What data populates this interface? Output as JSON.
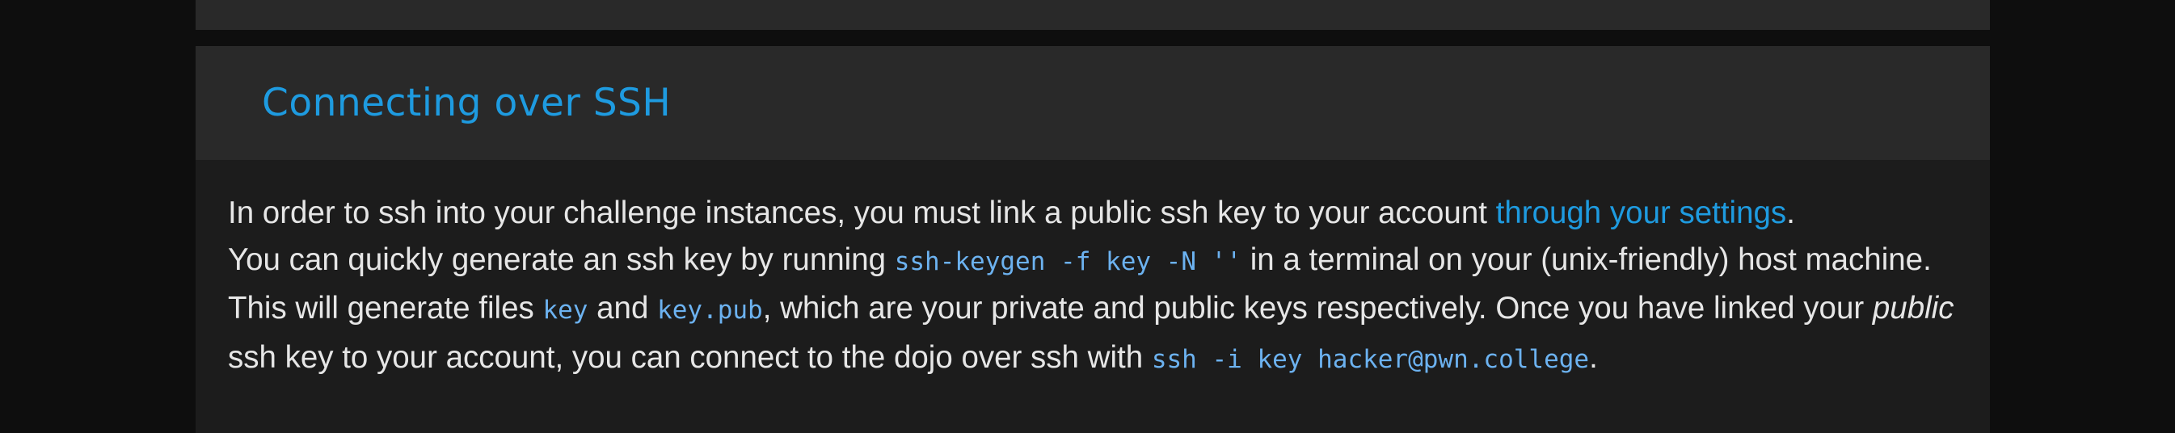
{
  "card": {
    "title": "Connecting over SSH"
  },
  "paragraph": {
    "s1_pre": "In order to ssh into your challenge instances, you must link a public ssh key to your account ",
    "settings_link": "through your settings",
    "s1_post": ".",
    "s2_pre": "You can quickly generate an ssh key by running ",
    "keygen_cmd": "ssh-keygen -f key -N ''",
    "s2_post": " in a terminal on your (unix-friendly) host machine. This will generate files ",
    "file_private": "key",
    "and_text": " and ",
    "file_public": "key.pub",
    "s3_pre": ", which are your private and public keys respectively. Once you have linked your ",
    "public_em": "public",
    "s3_post": " ssh key to your account, you can connect to the dojo over ssh with ",
    "ssh_cmd": "ssh -i key hacker@pwn.college",
    "end": "."
  }
}
